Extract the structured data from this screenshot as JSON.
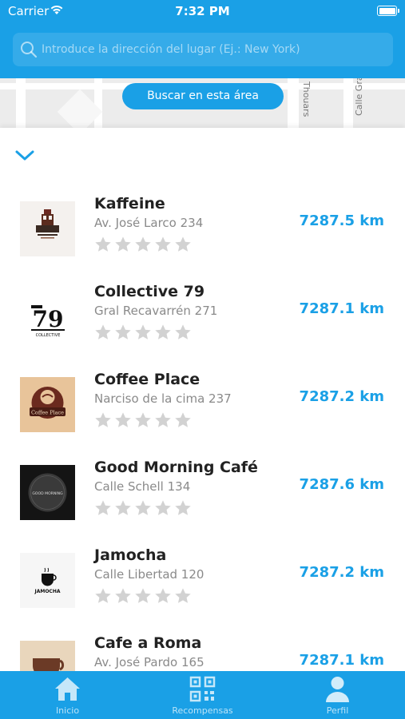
{
  "status_bar": {
    "carrier": "Carrier",
    "time": "7:32 PM"
  },
  "search": {
    "placeholder": "Introduce la dirección del lugar (Ej.: New York)",
    "value": ""
  },
  "map": {
    "button_label": "Buscar en esta área",
    "street_labels": [
      "Thouars",
      "Calle Gra"
    ]
  },
  "places": [
    {
      "name": "Kaffeine",
      "address": "Av. José Larco 234",
      "distance": "7287.5 km",
      "rating": 0,
      "logo": "kaffeine-logo"
    },
    {
      "name": "Collective 79",
      "address": "Gral Recavarrén 271",
      "distance": "7287.1 km",
      "rating": 0,
      "logo": "collective-79-logo",
      "logo_text": "79",
      "logo_caption": "COLLECTIVE"
    },
    {
      "name": "Coffee Place",
      "address": "Narciso de la cima 237",
      "distance": "7287.2 km",
      "rating": 0,
      "logo": "coffee-place-logo",
      "logo_text": "Coffee Place"
    },
    {
      "name": "Good Morning Café",
      "address": "Calle Schell 134",
      "distance": "7287.6 km",
      "rating": 0,
      "logo": "good-morning-logo",
      "logo_text": "GOOD MORNING"
    },
    {
      "name": "Jamocha",
      "address": "Calle Libertad 120",
      "distance": "7287.2 km",
      "rating": 0,
      "logo": "jamocha-logo",
      "logo_text": "JAMOCHA"
    },
    {
      "name": "Cafe a Roma",
      "address": "Av. José Pardo 165",
      "distance": "7287.1 km",
      "rating": 0,
      "logo": "cafe-a-roma-logo"
    }
  ],
  "tabs": [
    {
      "label": "Inicio",
      "icon": "home-icon"
    },
    {
      "label": "Recompensas",
      "icon": "qr-code-icon"
    },
    {
      "label": "Perfil",
      "icon": "profile-icon"
    }
  ],
  "colors": {
    "primary": "#1aa0e6",
    "star_empty": "#d2d2d2",
    "text_dark": "#222222",
    "text_muted": "#8a8a8a"
  }
}
